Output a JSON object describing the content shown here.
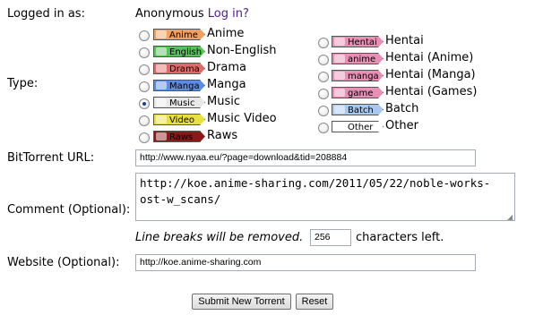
{
  "login": {
    "label": "Logged in as:",
    "user": "Anonymous",
    "link": "Log in?"
  },
  "type": {
    "label": "Type:",
    "left": [
      {
        "tag": "Anime",
        "name": "Anime",
        "tag_color": "#f0a060",
        "checked": false
      },
      {
        "tag": "English",
        "name": "Non-English",
        "tag_color": "#58c25a",
        "checked": false
      },
      {
        "tag": "Drama",
        "name": "Drama",
        "tag_color": "#e06a6a",
        "checked": false
      },
      {
        "tag": "Manga",
        "name": "Manga",
        "tag_color": "#5b8de0",
        "checked": false
      },
      {
        "tag": "Music",
        "name": "Music",
        "tag_color": "#e8e8e8",
        "checked": true
      },
      {
        "tag": "Video",
        "name": "Music Video",
        "tag_color": "#e8e040",
        "checked": false
      },
      {
        "tag": "Raws",
        "name": "Raws",
        "tag_color": "#8a1a1a",
        "checked": false
      }
    ],
    "right": [
      {
        "tag": "Hentai",
        "name": "Hentai",
        "tag_color": "#e78fb4",
        "checked": false
      },
      {
        "tag": "anime",
        "name": "Hentai (Anime)",
        "tag_color": "#e78fb4",
        "checked": false
      },
      {
        "tag": "manga",
        "name": "Hentai (Manga)",
        "tag_color": "#e78fb4",
        "checked": false
      },
      {
        "tag": "game",
        "name": "Hentai (Games)",
        "tag_color": "#e78fb4",
        "checked": false
      },
      {
        "tag": "Batch",
        "name": "Batch",
        "tag_color": "#a9c8ee",
        "checked": false
      },
      {
        "tag": "Other",
        "name": "Other",
        "tag_color": "#ffffff",
        "checked": false
      }
    ]
  },
  "bittorrent": {
    "label": "BitTorrent URL:",
    "value": "http://www.nyaa.eu/?page=download&tid=208884"
  },
  "comment": {
    "label": "Comment (Optional):",
    "value": "http://koe.anime-sharing.com/2011/05/22/noble-works-\nost-w_scans/",
    "note": "Line breaks will be removed.",
    "chars_left": "256",
    "chars_suffix": "characters left."
  },
  "website": {
    "label": "Website (Optional):",
    "value": "http://koe.anime-sharing.com"
  },
  "buttons": {
    "submit": "Submit New Torrent",
    "reset": "Reset"
  }
}
